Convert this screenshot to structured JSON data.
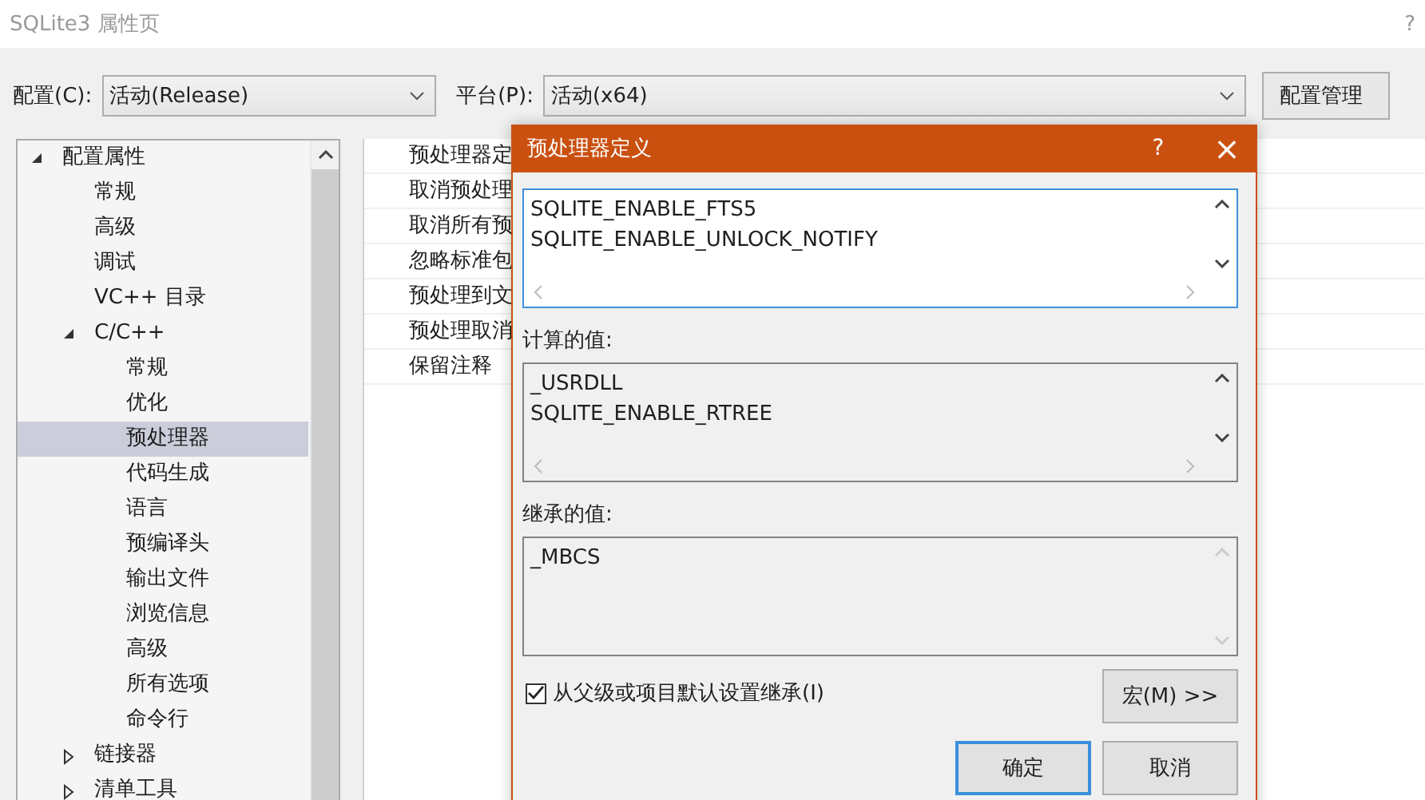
{
  "window": {
    "title": "SQLite3 属性页",
    "help": "?"
  },
  "config_bar": {
    "config_label": "配置(C):",
    "config_value": "活动(Release)",
    "platform_label": "平台(P):",
    "platform_value": "活动(x64)",
    "manager_button": "配置管理"
  },
  "tree": [
    {
      "label": "配置属性",
      "expanded": true,
      "selected": false,
      "children": [
        {
          "label": "常规",
          "selected": false
        },
        {
          "label": "高级",
          "selected": false
        },
        {
          "label": "调试",
          "selected": false
        },
        {
          "label": "VC++ 目录",
          "selected": false
        },
        {
          "label": "C/C++",
          "expanded": true,
          "selected": false,
          "children": [
            {
              "label": "常规",
              "selected": false
            },
            {
              "label": "优化",
              "selected": false
            },
            {
              "label": "预处理器",
              "selected": true
            },
            {
              "label": "代码生成",
              "selected": false
            },
            {
              "label": "语言",
              "selected": false
            },
            {
              "label": "预编译头",
              "selected": false
            },
            {
              "label": "输出文件",
              "selected": false
            },
            {
              "label": "浏览信息",
              "selected": false
            },
            {
              "label": "高级",
              "selected": false
            },
            {
              "label": "所有选项",
              "selected": false
            },
            {
              "label": "命令行",
              "selected": false
            }
          ]
        },
        {
          "label": "链接器",
          "expanded": false,
          "selected": false
        },
        {
          "label": "清单工具",
          "expanded": false,
          "selected": false
        }
      ]
    }
  ],
  "properties": [
    "预处理器定",
    "取消预处理",
    "取消所有预",
    "忽略标准包",
    "预处理到文",
    "预处理取消",
    "保留注释"
  ],
  "dialog": {
    "title": "预处理器定义",
    "help": "?",
    "close": "×",
    "definitions": [
      "SQLITE_ENABLE_FTS5",
      "SQLITE_ENABLE_UNLOCK_NOTIFY"
    ],
    "computed_label": "计算的值:",
    "computed_values": [
      "_USRDLL",
      "SQLITE_ENABLE_RTREE"
    ],
    "inherited_label": "继承的值:",
    "inherited_values": [
      "_MBCS"
    ],
    "inherit_checkbox": {
      "label": "从父级或项目默认设置继承(I)",
      "checked": true
    },
    "macro_button": "宏(M) >>",
    "ok_button": "确定",
    "cancel_button": "取消"
  }
}
